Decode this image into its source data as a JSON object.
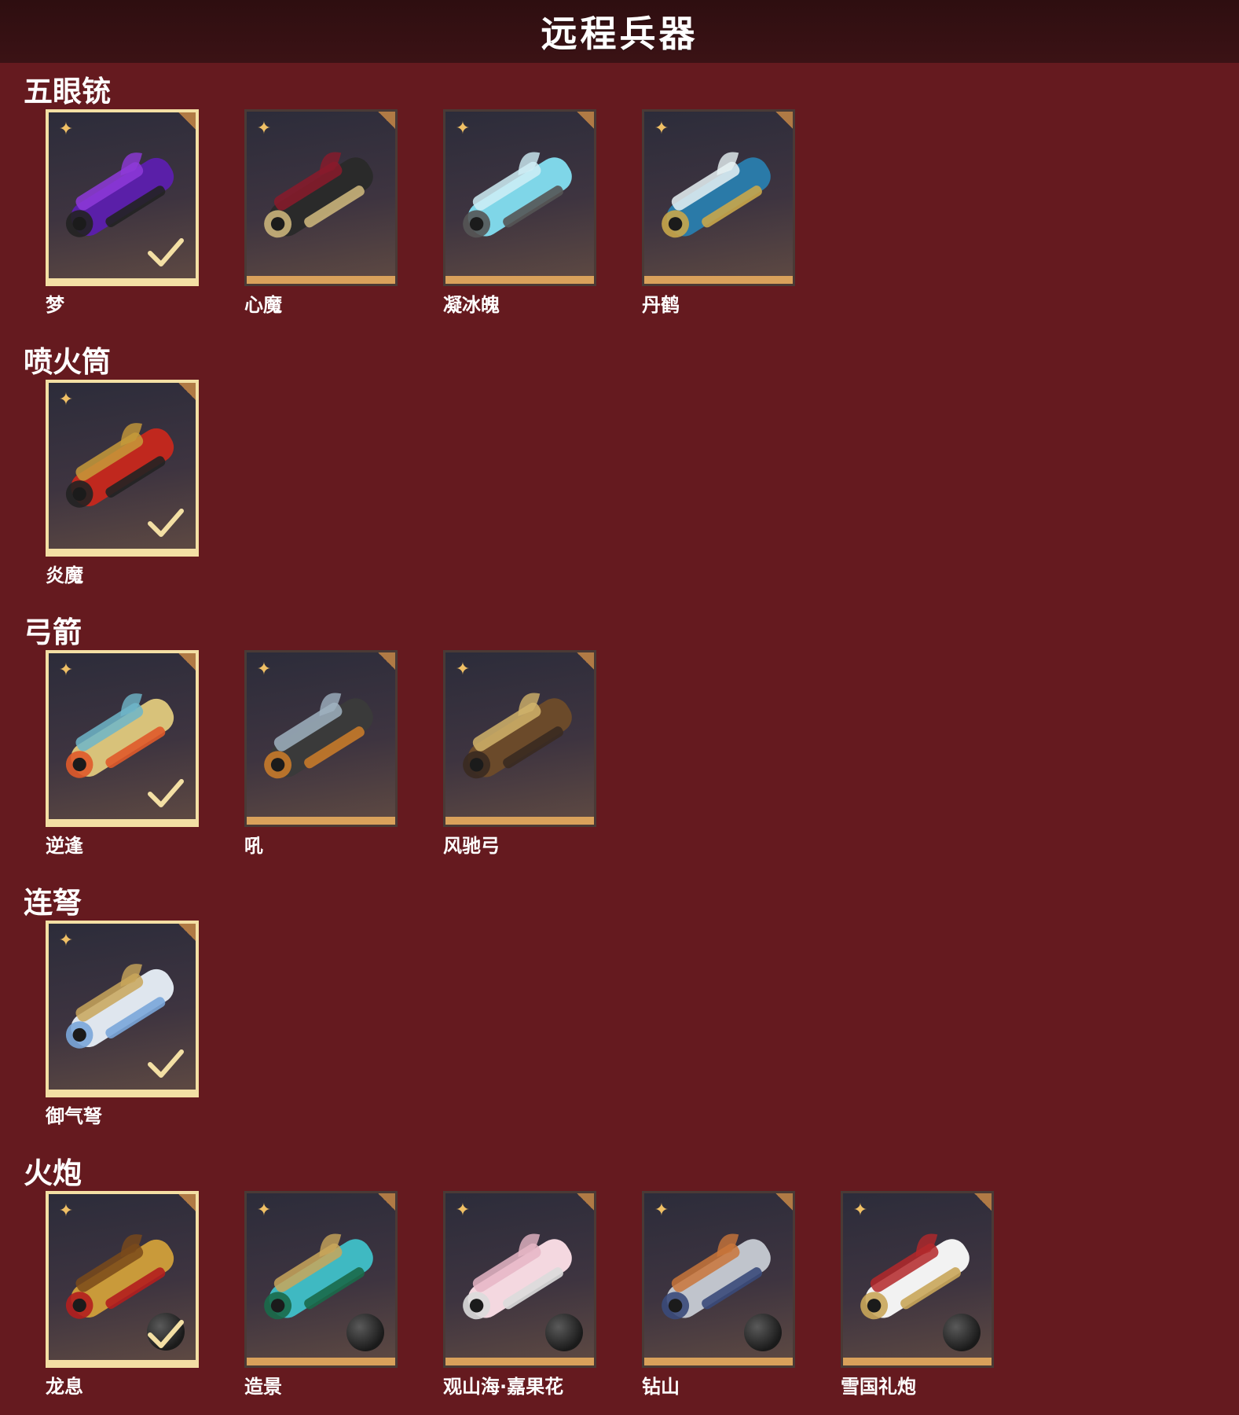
{
  "header": {
    "title": "远程兵器"
  },
  "sections": [
    {
      "title": "五眼铳",
      "items": [
        {
          "name": "梦",
          "selected": true,
          "colors": [
            "#5a1fa8",
            "#8e3ad9",
            "#222"
          ]
        },
        {
          "name": "心魔",
          "selected": false,
          "colors": [
            "#2a2a2a",
            "#8a1a2a",
            "#c9b27a"
          ]
        },
        {
          "name": "凝冰魄",
          "selected": false,
          "colors": [
            "#7fd6e8",
            "#cfeff6",
            "#555"
          ]
        },
        {
          "name": "丹鹤",
          "selected": false,
          "colors": [
            "#2a7aa8",
            "#e7f2f4",
            "#c8a64a"
          ]
        }
      ]
    },
    {
      "title": "喷火筒",
      "items": [
        {
          "name": "炎魔",
          "selected": true,
          "colors": [
            "#c0281e",
            "#c79a3a",
            "#222"
          ]
        }
      ]
    },
    {
      "title": "弓箭",
      "items": [
        {
          "name": "逆逢",
          "selected": true,
          "colors": [
            "#d8c27a",
            "#6fb6c9",
            "#e05a2a"
          ]
        },
        {
          "name": "吼",
          "selected": false,
          "colors": [
            "#3a3a3a",
            "#9fb2c0",
            "#c77a2a"
          ]
        },
        {
          "name": "风驰弓",
          "selected": false,
          "colors": [
            "#6b4a2a",
            "#d1b36a",
            "#3a2a20"
          ]
        }
      ]
    },
    {
      "title": "连弩",
      "items": [
        {
          "name": "御气弩",
          "selected": true,
          "colors": [
            "#dfe6ee",
            "#c9a65a",
            "#7aa6d9"
          ]
        }
      ]
    },
    {
      "title": "火炮",
      "items": [
        {
          "name": "龙息",
          "selected": true,
          "ammo": true,
          "colors": [
            "#c99a3a",
            "#7a4a1a",
            "#b21e1e"
          ]
        },
        {
          "name": "造景",
          "selected": false,
          "ammo": true,
          "colors": [
            "#3fb9c2",
            "#c9a65a",
            "#1a6a4a"
          ]
        },
        {
          "name": "观山海·嘉果花",
          "selected": false,
          "ammo": true,
          "colors": [
            "#f4d8e0",
            "#e6b6c6",
            "#dcdcdc"
          ]
        },
        {
          "name": "钻山",
          "selected": false,
          "ammo": true,
          "colors": [
            "#c0c4cc",
            "#c9763a",
            "#3a4a7a"
          ]
        },
        {
          "name": "雪国礼炮",
          "selected": false,
          "ammo": true,
          "colors": [
            "#f2f2f2",
            "#b4282a",
            "#c9a65a"
          ]
        }
      ]
    }
  ]
}
